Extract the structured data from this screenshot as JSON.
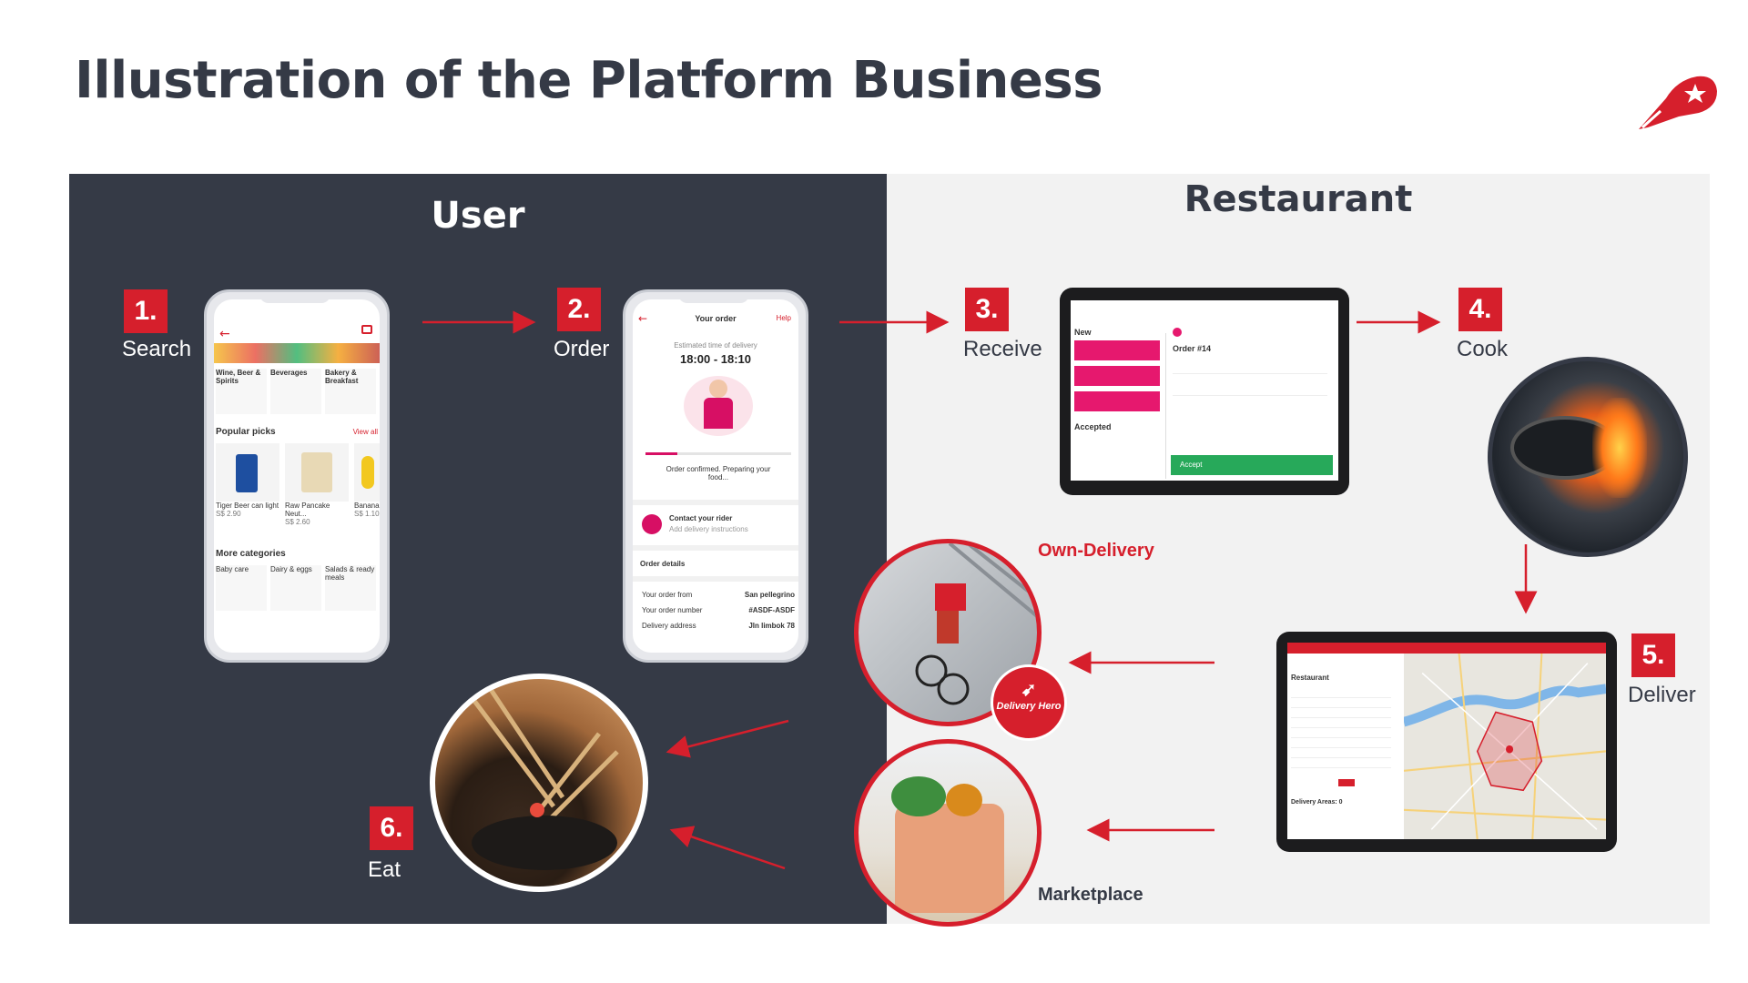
{
  "title": "Illustration of the Platform Business",
  "panels": {
    "user": "User",
    "restaurant": "Restaurant"
  },
  "steps": [
    {
      "number": "1.",
      "label": "Search"
    },
    {
      "number": "2.",
      "label": "Order"
    },
    {
      "number": "3.",
      "label": "Receive"
    },
    {
      "number": "4.",
      "label": "Cook"
    },
    {
      "number": "5.",
      "label": "Deliver"
    },
    {
      "number": "6.",
      "label": "Eat"
    }
  ],
  "delivery_modes": {
    "own": "Own-Delivery",
    "marketplace": "Marketplace"
  },
  "brand_badge": "Delivery Hero",
  "search_screen": {
    "categories": [
      "Wine, Beer & Spirits",
      "Beverages",
      "Bakery & Breakfast"
    ],
    "popular_title": "Popular picks",
    "view_all": "View all",
    "products": [
      {
        "name": "Tiger Beer can light",
        "price": "S$ 2.90"
      },
      {
        "name": "Raw Pancake Neut...",
        "price": "S$ 2.60"
      },
      {
        "name": "Banana",
        "price": "S$ 1.10"
      }
    ],
    "more_title": "More categories",
    "more_categories": [
      "Baby care",
      "Dairy & eggs",
      "Salads & ready meals"
    ]
  },
  "order_screen": {
    "header": "Your order",
    "help": "Help",
    "eta_label": "Estimated time of delivery",
    "eta": "18:00 - 18:10",
    "status": "Order confirmed. Preparing your food...",
    "contact": "Contact your rider",
    "contact_sub": "Add delivery instructions",
    "details_title": "Order details",
    "details": [
      {
        "key": "Your order from",
        "value": "San pellegrino"
      },
      {
        "key": "Your order number",
        "value": "#ASDF-ASDF"
      },
      {
        "key": "Delivery address",
        "value": "Jln limbok 78"
      }
    ]
  },
  "receive_screen": {
    "new_title": "New",
    "accepted_title": "Accepted",
    "order_title": "Order #14",
    "accept": "Accept"
  },
  "deliver_screen": {
    "section": "Restaurant",
    "delivery_areas": "Delivery Areas: 0"
  },
  "colors": {
    "brand_red": "#d61f2c",
    "dark_panel": "#353a46",
    "light_panel": "#f2f2f2"
  }
}
